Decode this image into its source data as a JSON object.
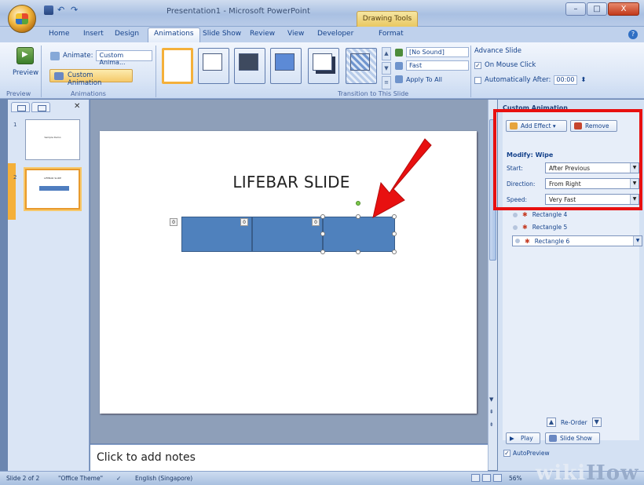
{
  "window": {
    "title": "Presentation1 - Microsoft PowerPoint",
    "context_tab": "Drawing Tools",
    "controls": [
      "–",
      "□",
      "X"
    ]
  },
  "ribbon_tabs": [
    "Home",
    "Insert",
    "Design",
    "Animations",
    "Slide Show",
    "Review",
    "View",
    "Developer",
    "Format"
  ],
  "ribbon": {
    "preview": {
      "button": "Preview",
      "group": "Preview"
    },
    "animations": {
      "animate_label": "Animate:",
      "animate_value": "Custom Anima...",
      "custom_animation": "Custom Animation",
      "group": "Animations"
    },
    "transition": {
      "sound_value": "[No Sound]",
      "speed_value": "Fast",
      "apply_all": "Apply To All",
      "group": "Transition to This Slide"
    },
    "advance": {
      "title": "Advance Slide",
      "on_mouse_click": "On Mouse Click",
      "auto_after": "Automatically After:",
      "auto_time": "00:00"
    }
  },
  "slides_pane": {
    "slides": [
      {
        "number": "1",
        "title": "Sample Demo"
      },
      {
        "number": "2",
        "title": "LIFEBAR SLIDE"
      }
    ]
  },
  "slide": {
    "title": "LIFEBAR SLIDE",
    "bar_tags": [
      "0",
      "0",
      "0"
    ]
  },
  "notes": {
    "placeholder": "Click to add notes"
  },
  "task_pane": {
    "header": "Custom Animation",
    "add_effect": "Add Effect",
    "remove": "Remove",
    "modify": "Modify: Wipe",
    "start_label": "Start:",
    "start_value": "After Previous",
    "direction_label": "Direction:",
    "direction_value": "From Right",
    "speed_label": "Speed:",
    "speed_value": "Very Fast",
    "effects": [
      "Rectangle 4",
      "Rectangle 5",
      "Rectangle 6"
    ],
    "reorder": "Re-Order",
    "play": "Play",
    "slide_show": "Slide Show",
    "autopreview": "AutoPreview"
  },
  "status": {
    "slide": "Slide 2 of 2",
    "theme": "\"Office Theme\"",
    "language": "English (Singapore)",
    "zoom": "56%"
  },
  "watermark": {
    "wiki": "wiki",
    "how": "How"
  },
  "colors": {
    "highlight_box": "#e81010",
    "annotation_arrow": "#e81010",
    "shape_fill": "#4f81bd"
  }
}
